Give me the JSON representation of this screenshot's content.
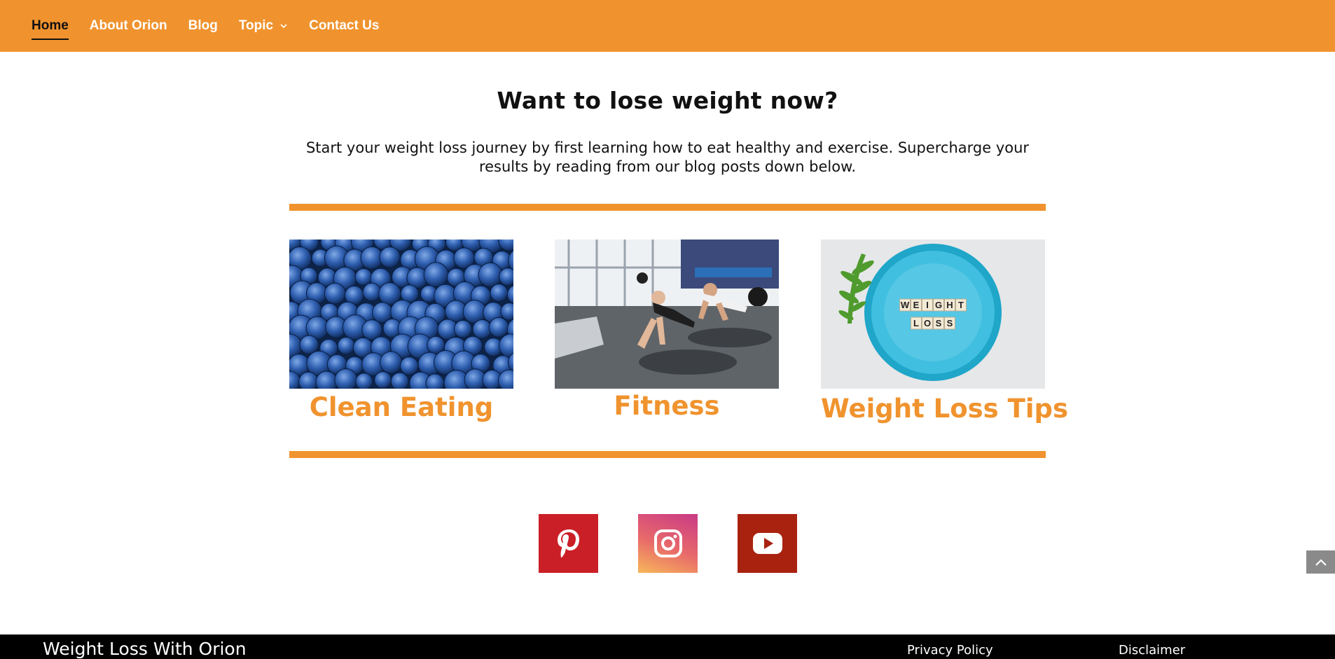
{
  "nav": {
    "items": [
      {
        "label": "Home",
        "active": true
      },
      {
        "label": "About Orion"
      },
      {
        "label": "Blog"
      },
      {
        "label": "Topic",
        "has_dropdown": true
      },
      {
        "label": "Contact Us"
      }
    ]
  },
  "hero": {
    "title": "Want to lose weight now?",
    "subtitle": "Start your weight loss journey by first learning how to eat healthy and exercise. Supercharge your results by reading from our blog posts down below."
  },
  "cards": [
    {
      "title": "Clean Eating",
      "image": "blueberries-photo"
    },
    {
      "title": "Fitness",
      "image": "gym-pushups-photo"
    },
    {
      "title": "Weight Loss Tips",
      "image": "weight-loss-plate-photo"
    }
  ],
  "plate_tiles": {
    "line1": [
      "W",
      "E",
      "I",
      "G",
      "H",
      "T"
    ],
    "line2": [
      "L",
      "O",
      "S",
      "S"
    ]
  },
  "social": [
    {
      "name": "pinterest-icon",
      "color": "#cb1f27"
    },
    {
      "name": "instagram-icon",
      "color": "#e0607a"
    },
    {
      "name": "youtube-icon",
      "color": "#a92210"
    }
  ],
  "footer": {
    "brand": "Weight Loss With Orion",
    "links": [
      "Privacy Policy",
      "Disclaimer"
    ]
  },
  "colors": {
    "accent": "#f0932e",
    "footer_bg": "#000000"
  }
}
